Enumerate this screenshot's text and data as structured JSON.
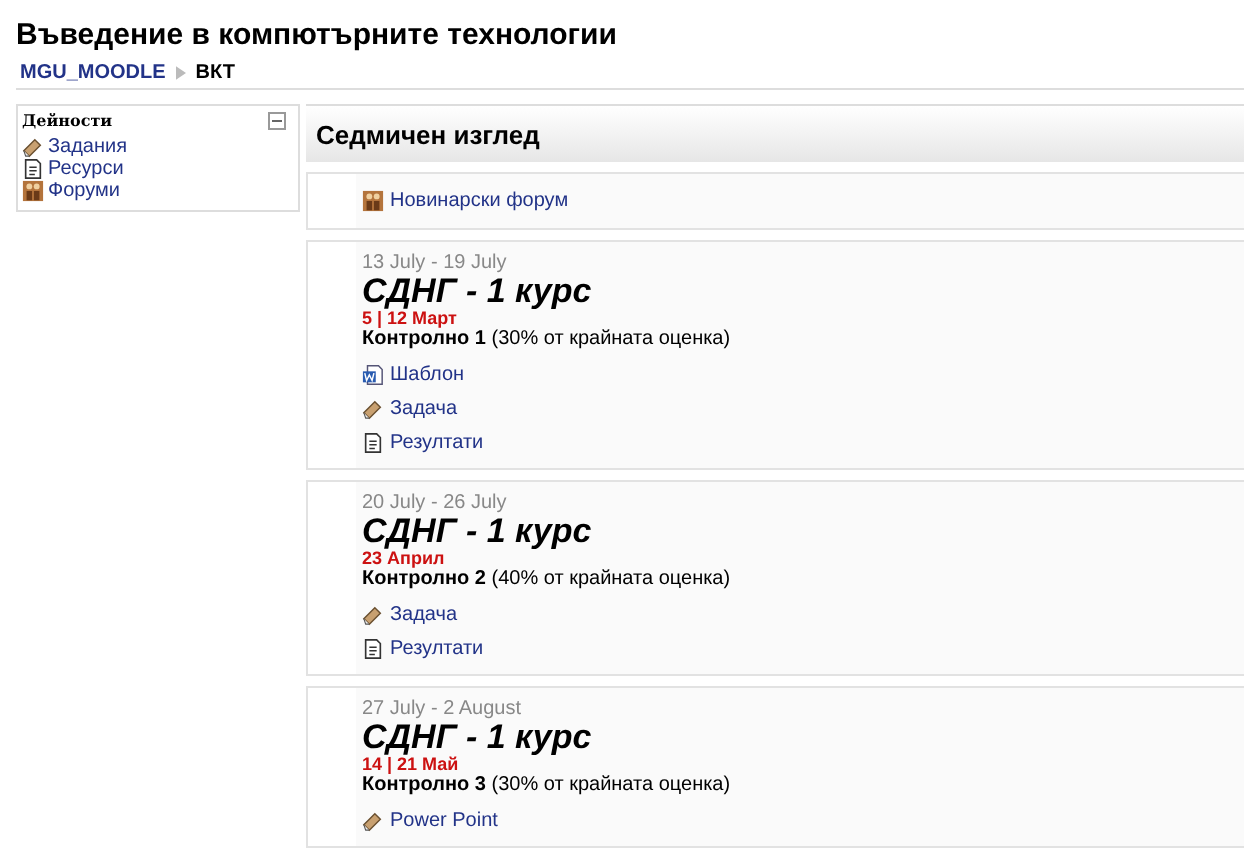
{
  "title": "Въведение в компютърните технологии",
  "breadcrumb": [
    {
      "label": "MGU_MOODLE",
      "link": true
    },
    {
      "label": "ВКТ",
      "link": false
    }
  ],
  "sidebar": {
    "title": "Дейности",
    "items": [
      {
        "label": "Задания",
        "kind": "assignment"
      },
      {
        "label": "Ресурси",
        "kind": "resource"
      },
      {
        "label": "Форуми",
        "kind": "forum"
      }
    ]
  },
  "main": {
    "heading": "Седмичен изглед",
    "news": {
      "label": "Новинарски форум",
      "kind": "forum"
    },
    "weeks": [
      {
        "dates": "13 July - 19 July",
        "title": "СДНГ - 1 курс",
        "date_note": "5 | 12 Март",
        "control": "**Контролно 1** (30% от крайната оценка)",
        "items": [
          {
            "label": "Шаблон",
            "kind": "document"
          },
          {
            "label": "Задача",
            "kind": "assignment"
          },
          {
            "label": "Резултати",
            "kind": "resource"
          }
        ]
      },
      {
        "dates": "20 July - 26 July",
        "title": "СДНГ - 1 курс",
        "date_note": "23 Април",
        "control": "**Контролно 2** (40% от крайната оценка)",
        "items": [
          {
            "label": "Задача",
            "kind": "assignment"
          },
          {
            "label": "Резултати",
            "kind": "resource"
          }
        ]
      },
      {
        "dates": "27 July - 2 August",
        "title": "СДНГ - 1 курс",
        "date_note": "14 | 21 Май",
        "control": "**Контролно 3** (30% от крайната оценка)",
        "items": [
          {
            "label": "Power Point",
            "kind": "assignment"
          }
        ]
      }
    ]
  }
}
